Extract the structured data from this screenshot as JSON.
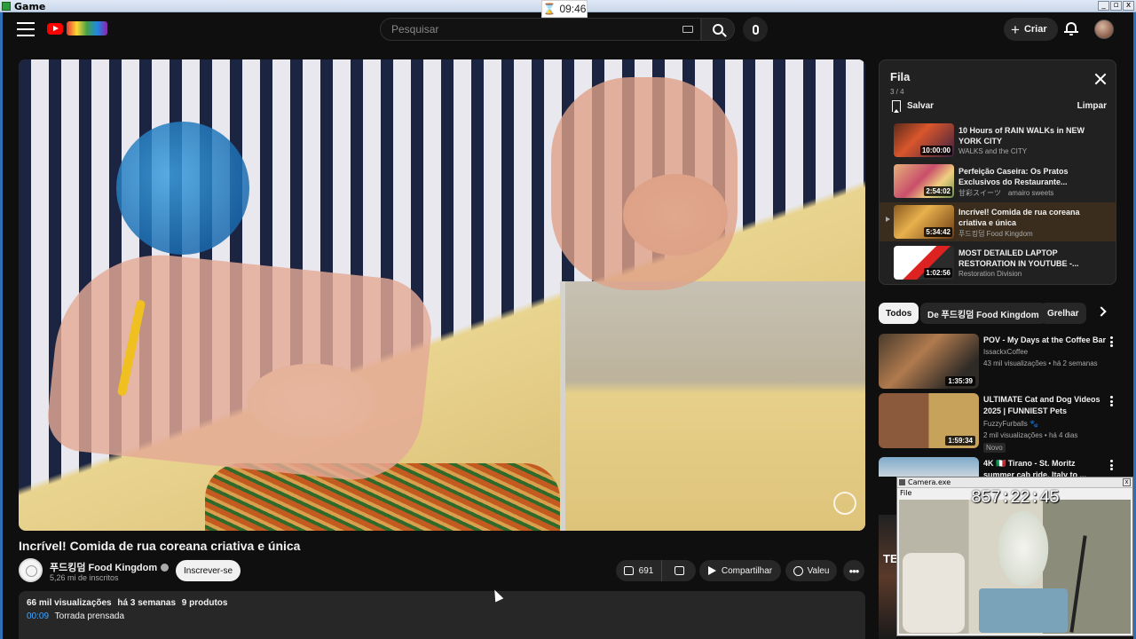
{
  "os": {
    "app_title": "Game",
    "timer": "09:46",
    "win_buttons": [
      "_",
      "▫",
      "x"
    ]
  },
  "masthead": {
    "search_placeholder": "Pesquisar",
    "create_label": "Criar",
    "icons": [
      "menu-icon",
      "youtube-logo",
      "keyboard-icon",
      "search-icon",
      "mic-icon",
      "plus-icon",
      "bell-icon",
      "avatar"
    ]
  },
  "video": {
    "title": "Incrível! Comida de rua coreana criativa e única",
    "channel": "푸드킹덤 Food Kingdom",
    "subscribers": "5,26 mi de inscritos",
    "subscribe_label": "Inscrever-se",
    "likes": "691",
    "share_label": "Compartilhar",
    "thanks_label": "Valeu",
    "more_label": "•••"
  },
  "description": {
    "views": "66 mil visualizações",
    "date": "há 3 semanas",
    "products": "9 produtos",
    "chapter_time": "00:09",
    "chapter_title": "Torrada prensada"
  },
  "queue": {
    "title": "Fila",
    "count": "3 / 4",
    "save_label": "Salvar",
    "clear_label": "Limpar",
    "items": [
      {
        "title": "10 Hours of RAIN WALKs in NEW YORK CITY",
        "channel": "WALKS and the CITY",
        "duration": "10:00:00",
        "active": false
      },
      {
        "title": "Perfeição Caseira: Os Pratos Exclusivos do Restaurante...",
        "channel": "甘彩スイーツ　amairo sweets",
        "duration": "2:54:02",
        "active": false
      },
      {
        "title": "Incrível! Comida de rua coreana criativa e única",
        "channel": "푸드킹덤 Food Kingdom",
        "duration": "5:34:42",
        "active": true
      },
      {
        "title": "MOST DETAILED LAPTOP RESTORATION IN YOUTUBE -...",
        "channel": "Restoration Division",
        "duration": "1:02:56",
        "active": false
      }
    ]
  },
  "chips": [
    "Todos",
    "De 푸드킹덤 Food Kingdom",
    "Grelhar"
  ],
  "recommendations": [
    {
      "title": "POV - My Days at the Coffee Bar",
      "channel": "IssackxCoffee",
      "meta": "43 mil visualizações • há 2 semanas",
      "duration": "1:35:39",
      "badge": ""
    },
    {
      "title": "ULTIMATE Cat and Dog Videos 2025 | FUNNIEST Pets",
      "channel": "FuzzyFurballs 🐾",
      "meta": "2 mil visualizações • há 4 dias",
      "duration": "1:59:34",
      "badge": "Novo"
    },
    {
      "title": "4K 🇮🇹 Tirano - St. Moritz summer cab ride, Italy to ...",
      "channel": "",
      "meta": "",
      "duration": "",
      "badge": ""
    }
  ],
  "side_strip_text": "TE",
  "camera_overlay": {
    "title": "Camera.exe",
    "clock": "857:22:45",
    "menu": "File"
  }
}
